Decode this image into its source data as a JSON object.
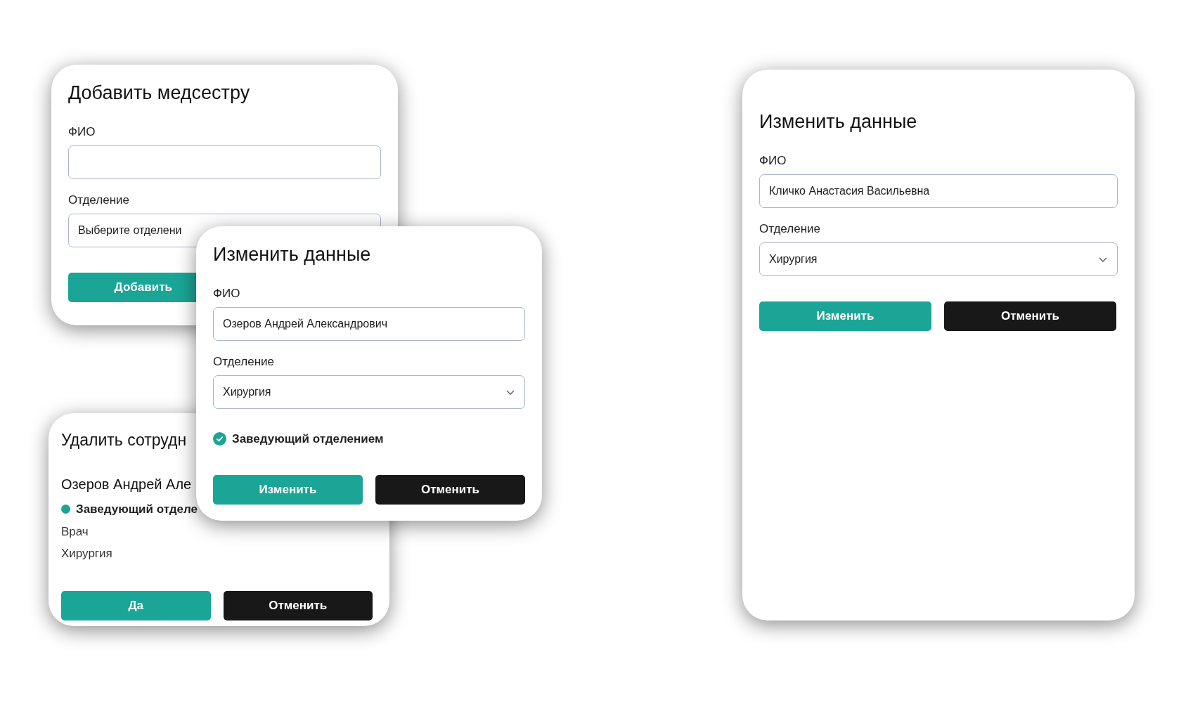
{
  "dialogs": [
    {
      "title": "Добавить медсестру",
      "fields": [
        {
          "kind": "text",
          "label": "ФИО"
        },
        {
          "kind": "select",
          "label": "Отделение",
          "placeholder": "Выберите отделени"
        }
      ],
      "buttons": [
        {
          "label": "Добавить",
          "kind": "primary"
        }
      ]
    },
    {
      "title": "Удалить сотрудн",
      "lines": [
        {
          "kind": "name",
          "text": "Озеров Андрей Але"
        },
        {
          "kind": "status",
          "text": "Заведующий отделе"
        },
        {
          "kind": "plain",
          "text": "Врач"
        },
        {
          "kind": "plain",
          "text": "Хирургия"
        }
      ],
      "buttons": [
        {
          "label": "Да",
          "kind": "primary"
        },
        {
          "label": "Отменить",
          "kind": "secondary"
        }
      ]
    },
    {
      "title": "Изменить данные",
      "fields": [
        {
          "kind": "text",
          "label": "ФИО",
          "value": "Озеров Андрей Александрович"
        },
        {
          "kind": "select",
          "label": "Отделение",
          "value": "Хирургия"
        },
        {
          "kind": "checkbox",
          "label": "Заведующий отделением",
          "checked": true
        }
      ],
      "buttons": [
        {
          "label": "Изменить",
          "kind": "primary"
        },
        {
          "label": "Отменить",
          "kind": "secondary"
        }
      ]
    },
    {
      "title": "Изменить данные",
      "fields": [
        {
          "kind": "text",
          "label": "ФИО",
          "value": "Кличко Анастасия Васильевна"
        },
        {
          "kind": "select",
          "label": "Отделение",
          "value": "Хирургия"
        }
      ],
      "buttons": [
        {
          "label": "Изменить",
          "kind": "primary"
        },
        {
          "label": "Отменить",
          "kind": "secondary"
        }
      ]
    }
  ]
}
